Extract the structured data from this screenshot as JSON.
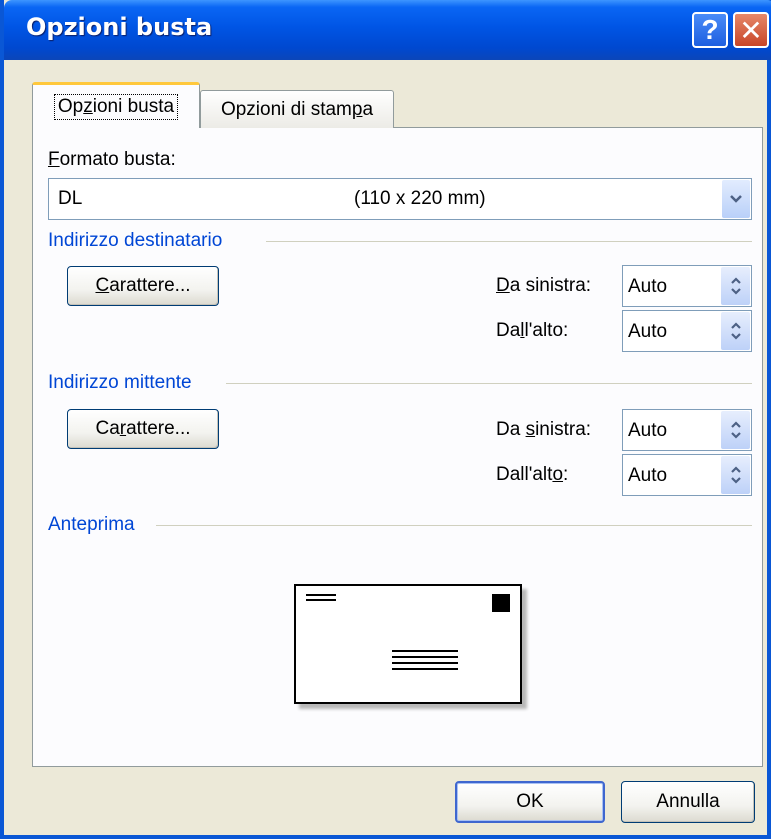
{
  "window": {
    "title": "Opzioni busta"
  },
  "tabs": [
    {
      "pre": "Op",
      "u": "z",
      "post": "ioni busta",
      "active": true
    },
    {
      "pre": "Opzioni di stam",
      "u": "p",
      "post": "a",
      "active": false
    }
  ],
  "format": {
    "label_u": "F",
    "label_rest": "ormato busta:",
    "selected_name": "DL",
    "selected_size": "(110 x 220 mm)"
  },
  "recipient": {
    "section_title": "Indirizzo destinatario",
    "font_button": {
      "u": "C",
      "rest": "arattere..."
    },
    "left": {
      "label_u": "D",
      "label_rest": "a sinistra:",
      "value": "Auto"
    },
    "top": {
      "label_pre": "Da",
      "label_u": "l",
      "label_post": "l'alto:",
      "value": "Auto"
    }
  },
  "sender": {
    "section_title": "Indirizzo mittente",
    "font_button": {
      "pre": "Ca",
      "u": "r",
      "post": "attere..."
    },
    "left": {
      "label_pre": "Da ",
      "label_u": "s",
      "label_post": "inistra:",
      "value": "Auto"
    },
    "top": {
      "label_pre": "Dall'alt",
      "label_u": "o",
      "label_post": ":",
      "value": "Auto"
    }
  },
  "preview": {
    "section_title": "Anteprima"
  },
  "buttons": {
    "ok": "OK",
    "cancel": "Annulla"
  },
  "icons": {
    "help": "help-icon",
    "close": "close-icon",
    "dropdown": "chevron-down-icon",
    "spin": "spin-up-down-icon"
  }
}
